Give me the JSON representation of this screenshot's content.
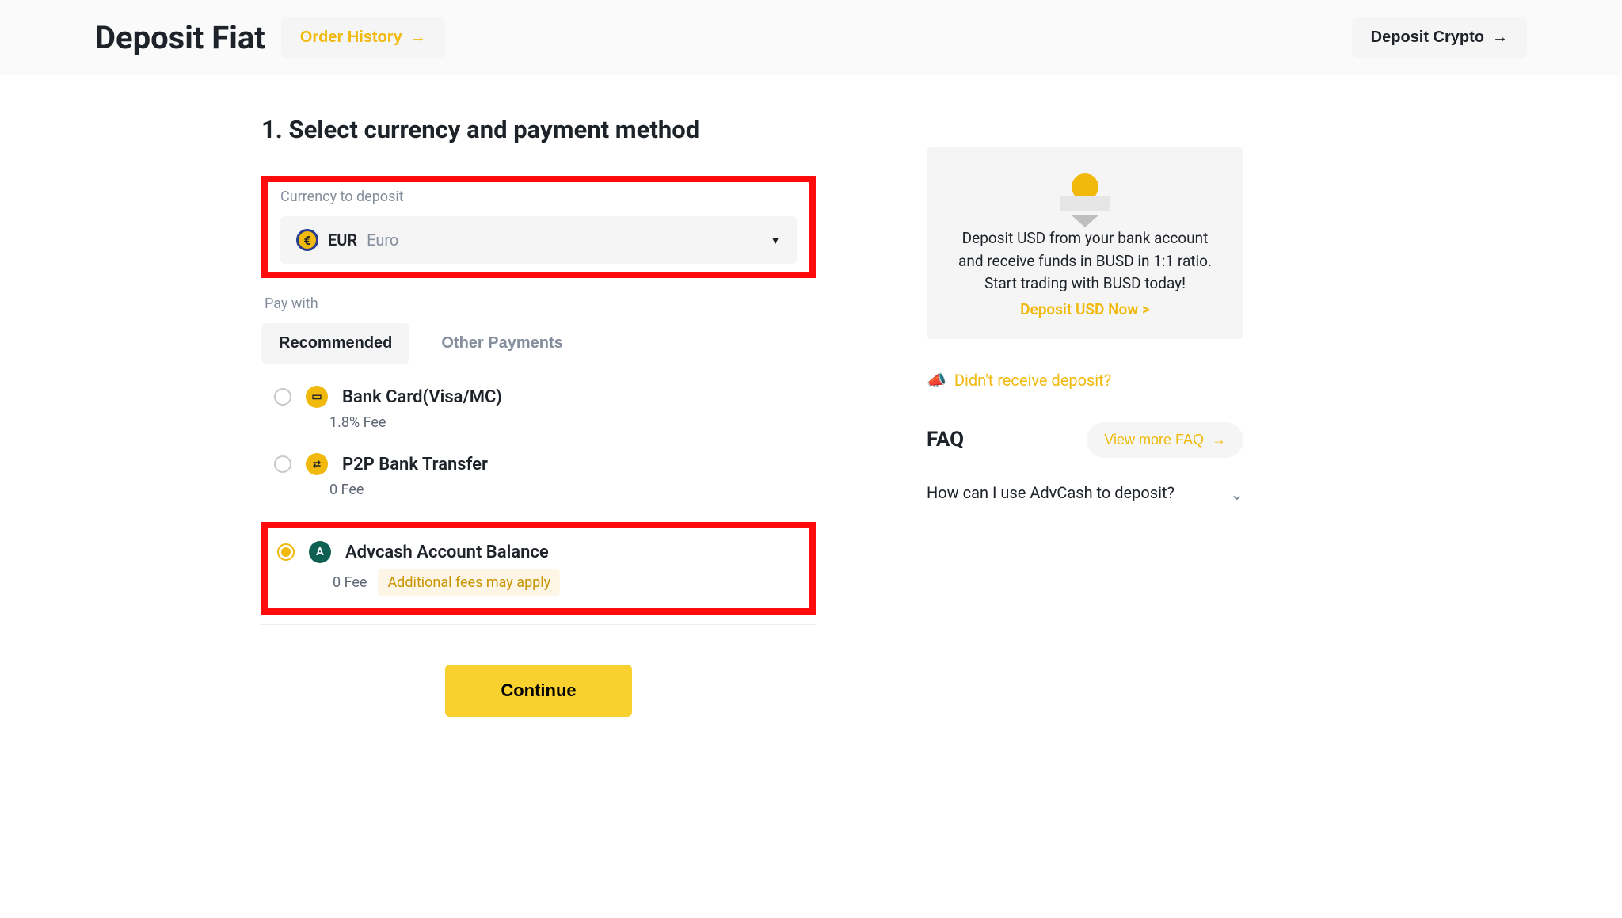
{
  "header": {
    "title": "Deposit Fiat",
    "order_history": "Order History",
    "deposit_crypto": "Deposit Crypto"
  },
  "step": {
    "title": "1. Select currency and payment method",
    "currency_label": "Currency to deposit",
    "currency_code": "EUR",
    "currency_name": "Euro",
    "pay_with_label": "Pay with",
    "tabs": {
      "recommended": "Recommended",
      "other": "Other Payments"
    },
    "methods": [
      {
        "name": "Bank Card(Visa/MC)",
        "fee": "1.8% Fee",
        "selected": false
      },
      {
        "name": "P2P Bank Transfer",
        "fee": "0 Fee",
        "selected": false
      },
      {
        "name": "Advcash Account Balance",
        "fee": "0 Fee",
        "note": "Additional fees may apply",
        "selected": true
      }
    ],
    "continue": "Continue"
  },
  "promo": {
    "text": "Deposit USD from your bank account and receive funds in BUSD in 1:1 ratio. Start trading with BUSD today!",
    "link": "Deposit USD Now >"
  },
  "help": {
    "not_received": "Didn't receive deposit?"
  },
  "faq": {
    "title": "FAQ",
    "more": "View more FAQ",
    "q1": "How can I use AdvCash to deposit?"
  }
}
